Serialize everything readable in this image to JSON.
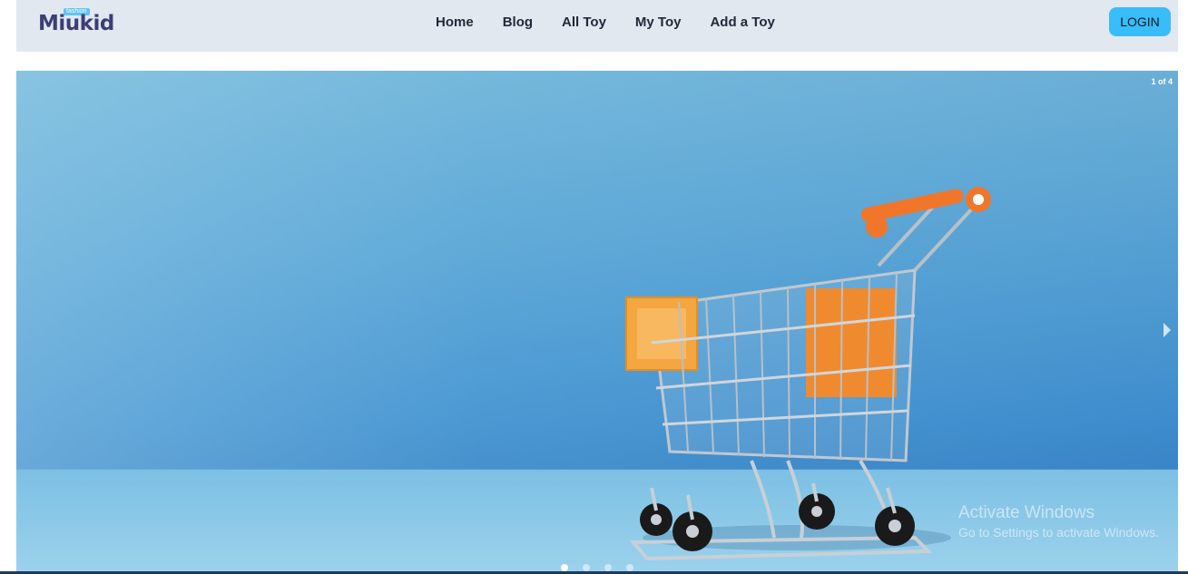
{
  "brand": {
    "badge": "fashion",
    "name": "Miukid"
  },
  "nav": {
    "items": [
      {
        "label": "Home"
      },
      {
        "label": "Blog"
      },
      {
        "label": "All Toy"
      },
      {
        "label": "My Toy"
      },
      {
        "label": "Add a Toy"
      }
    ],
    "login_label": "LOGIN",
    "login_color": "#38bdf8",
    "bar_color": "#e2e8f0"
  },
  "carousel": {
    "counter": "1 of 4",
    "current_slide": 1,
    "total_slides": 4,
    "slide_image": "shopping-cart-image",
    "next_icon": "chevron-right-icon"
  },
  "watermark": {
    "title": "Activate Windows",
    "subtitle": "Go to Settings to activate Windows."
  }
}
